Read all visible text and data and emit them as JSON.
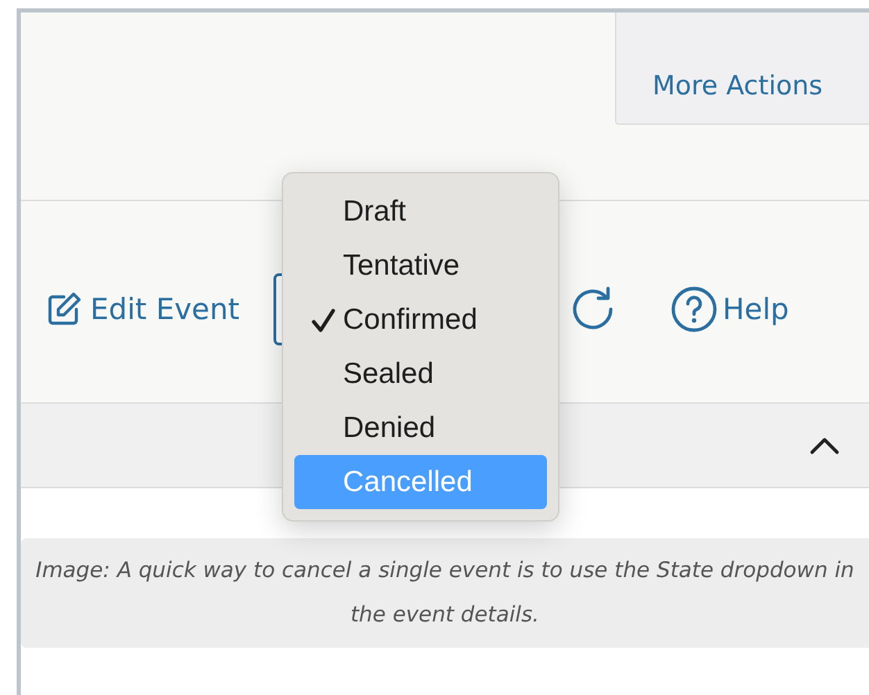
{
  "header": {
    "more_actions": "More Actions"
  },
  "toolbar": {
    "edit_event": "Edit Event",
    "help": "Help"
  },
  "section": {
    "expanded": true
  },
  "state_dropdown": {
    "options": [
      {
        "label": "Draft",
        "checked": false,
        "highlighted": false
      },
      {
        "label": "Tentative",
        "checked": false,
        "highlighted": false
      },
      {
        "label": "Confirmed",
        "checked": true,
        "highlighted": false
      },
      {
        "label": "Sealed",
        "checked": false,
        "highlighted": false
      },
      {
        "label": "Denied",
        "checked": false,
        "highlighted": false
      },
      {
        "label": "Cancelled",
        "checked": false,
        "highlighted": true
      }
    ]
  },
  "caption": "Image: A quick way to cancel a single event is to use the State dropdown in the event details."
}
